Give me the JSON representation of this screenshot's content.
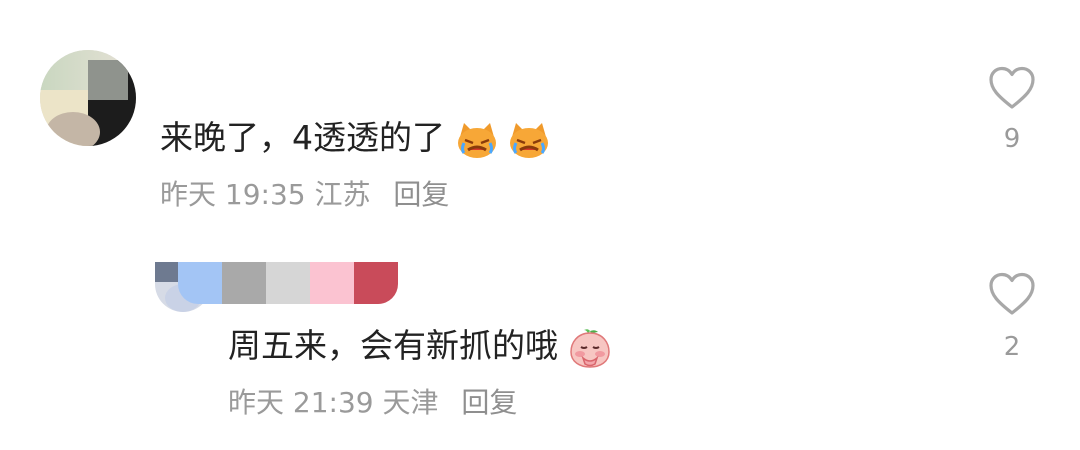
{
  "comments": [
    {
      "text": "来晚了，4透透的了",
      "emojis": [
        "crying-cat-emoji",
        "crying-cat-emoji"
      ],
      "time": "昨天 19:35",
      "location": "江苏",
      "reply_label": "回复",
      "likes": "9"
    },
    {
      "text": "周五来，会有新抓的哦",
      "emojis": [
        "pleading-peach-emoji"
      ],
      "time": "昨天 21:39",
      "location": "天津",
      "reply_label": "回复",
      "likes": "2",
      "name_colors": [
        "#6e7a90",
        "#a3c5f5",
        "#a9a9a9",
        "#d6d6d6",
        "#fbc3d1",
        "#c94b5a"
      ]
    }
  ],
  "colors": {
    "text": "#222222",
    "meta": "#9a9a9a",
    "heart_outline": "#a8a8a8"
  }
}
